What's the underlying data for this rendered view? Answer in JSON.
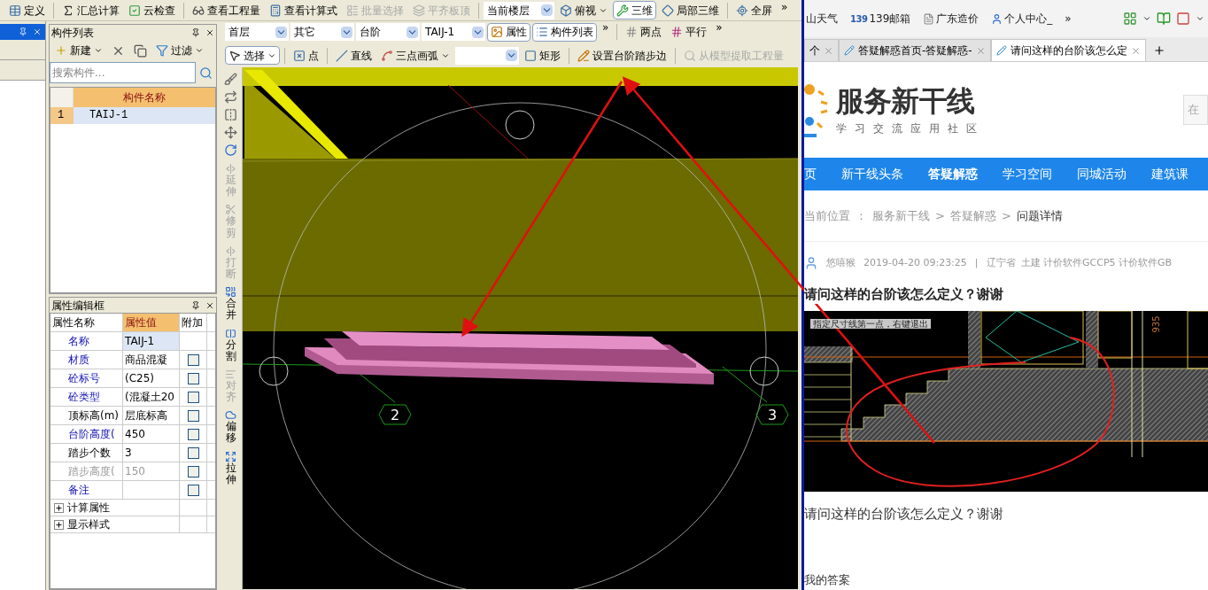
{
  "main_toolbar": [
    {
      "kind": "button",
      "label": "定义",
      "disabled": false,
      "pressed": false,
      "caret": false
    },
    {
      "kind": "separator"
    },
    {
      "kind": "button",
      "label": "汇总计算",
      "disabled": false,
      "pressed": false,
      "caret": false
    },
    {
      "kind": "button",
      "label": "云检查",
      "disabled": false,
      "pressed": false,
      "caret": false
    },
    {
      "kind": "separator"
    },
    {
      "kind": "button",
      "label": "查看工程量",
      "disabled": false,
      "pressed": false,
      "caret": false
    },
    {
      "kind": "button",
      "label": "查看计算式",
      "disabled": false,
      "pressed": false,
      "caret": false
    },
    {
      "kind": "button",
      "label": "批量选择",
      "disabled": true,
      "pressed": false,
      "caret": false
    },
    {
      "kind": "button",
      "label": "平齐板顶",
      "disabled": true,
      "pressed": false,
      "caret": false
    },
    {
      "kind": "separator"
    },
    {
      "kind": "dropdown",
      "value": "当前楼层"
    },
    {
      "kind": "button",
      "label": "俯视",
      "disabled": false,
      "pressed": false,
      "caret": true
    },
    {
      "kind": "button",
      "label": "三维",
      "disabled": false,
      "pressed": true,
      "caret": false
    },
    {
      "kind": "button",
      "label": "局部三维",
      "disabled": false,
      "pressed": false,
      "caret": false
    },
    {
      "kind": "separator"
    },
    {
      "kind": "button",
      "label": "全屏",
      "disabled": false,
      "pressed": false,
      "caret": false
    },
    {
      "kind": "more",
      "label": "»"
    }
  ],
  "component_list": {
    "title": "构件列表",
    "toolbar": [
      {
        "kind": "button",
        "label": "新建",
        "disabled": false,
        "pressed": false,
        "caret": true
      },
      {
        "kind": "icon"
      },
      {
        "kind": "icon"
      },
      {
        "kind": "button",
        "label": "过滤",
        "disabled": false,
        "pressed": false,
        "caret": true
      }
    ],
    "search": {
      "placeholder": "搜索构件..."
    },
    "column": "构件名称",
    "rows": [
      {
        "index": "1",
        "name": "TAIJ-1",
        "selected": true
      }
    ]
  },
  "property_editor": {
    "title": "属性编辑框",
    "columns": [
      "属性名称",
      "属性值",
      "附加"
    ],
    "rows": [
      {
        "name": "名称",
        "value": "TAIJ-1",
        "kind": "public",
        "checkbox": false,
        "selected": true
      },
      {
        "name": "材质",
        "value": "商品混凝",
        "kind": "public",
        "checkbox": true,
        "selected": false
      },
      {
        "name": "砼标号",
        "value": "(C25)",
        "kind": "public",
        "checkbox": true,
        "selected": false
      },
      {
        "name": "砼类型",
        "value": "(混凝土20",
        "kind": "public",
        "checkbox": true,
        "selected": false
      },
      {
        "name": "顶标高(m)",
        "value": "层底标高",
        "kind": "private",
        "checkbox": true,
        "selected": false
      },
      {
        "name": "台阶高度(",
        "value": "450",
        "kind": "public",
        "checkbox": true,
        "selected": false
      },
      {
        "name": "踏步个数",
        "value": "3",
        "kind": "private",
        "checkbox": true,
        "selected": false
      },
      {
        "name": "踏步高度(",
        "value": "150",
        "kind": "disabled",
        "checkbox": true,
        "selected": false
      },
      {
        "name": "备注",
        "value": "",
        "kind": "public",
        "checkbox": true,
        "selected": false
      }
    ],
    "groups": [
      {
        "label": "计算属性",
        "expanded": false
      },
      {
        "label": "显示样式",
        "expanded": false
      }
    ]
  },
  "floor_toolbar": [
    {
      "kind": "dropdown",
      "value": "首层"
    },
    {
      "kind": "dropdown",
      "value": "其它"
    },
    {
      "kind": "dropdown",
      "value": "台阶"
    },
    {
      "kind": "dropdown",
      "value": "TAIJ-1"
    },
    {
      "kind": "button",
      "label": "属性",
      "disabled": false,
      "pressed": true,
      "caret": false
    },
    {
      "kind": "button",
      "label": "构件列表",
      "disabled": false,
      "pressed": true,
      "caret": false
    },
    {
      "kind": "more",
      "label": "»"
    },
    {
      "kind": "separator"
    },
    {
      "kind": "button",
      "label": "两点",
      "disabled": false,
      "pressed": false,
      "caret": false
    },
    {
      "kind": "button",
      "label": "平行",
      "disabled": false,
      "pressed": false,
      "caret": false
    },
    {
      "kind": "more",
      "label": "»"
    }
  ],
  "draw_toolbar": [
    {
      "kind": "button",
      "label": "选择",
      "disabled": false,
      "pressed": true,
      "caret": true
    },
    {
      "kind": "separator"
    },
    {
      "kind": "button",
      "label": "点",
      "disabled": false,
      "pressed": false,
      "caret": false
    },
    {
      "kind": "separator"
    },
    {
      "kind": "button",
      "label": "直线",
      "disabled": false,
      "pressed": false,
      "caret": false
    },
    {
      "kind": "button",
      "label": "三点画弧",
      "disabled": false,
      "pressed": false,
      "caret": true
    },
    {
      "kind": "dropdown"
    },
    {
      "kind": "button",
      "label": "矩形",
      "disabled": false,
      "pressed": false,
      "caret": false
    },
    {
      "kind": "separator"
    },
    {
      "kind": "button",
      "label": "设置台阶踏步边",
      "disabled": false,
      "pressed": false,
      "caret": false
    },
    {
      "kind": "separator"
    },
    {
      "kind": "button",
      "label": "从模型提取工程量",
      "disabled": true,
      "pressed": false,
      "caret": false
    }
  ],
  "edit_tools": [
    {
      "label": "延伸",
      "disabled": true
    },
    {
      "label": "修剪",
      "disabled": true
    },
    {
      "label": "打断",
      "disabled": true
    },
    {
      "label": "合并",
      "disabled": false
    },
    {
      "label": "分割",
      "disabled": false
    },
    {
      "label": "对齐",
      "disabled": true
    },
    {
      "label": "偏移",
      "disabled": false
    },
    {
      "label": "拉伸",
      "disabled": false
    }
  ],
  "viewport": {
    "axis_labels": [
      "2",
      "3"
    ]
  },
  "browser": {
    "bookmarks": [
      {
        "label": "山天气"
      },
      {
        "label": "139邮箱",
        "badge": "139"
      },
      {
        "label": "广东造价"
      },
      {
        "label": "个人中心_"
      },
      {
        "label": "»"
      }
    ],
    "tabs": [
      {
        "label": "个",
        "selected": false
      },
      {
        "label": "答疑解惑首页-答疑解惑-",
        "selected": false
      },
      {
        "label": "请问这样的台阶该怎么定",
        "selected": true
      }
    ],
    "logo": {
      "title": "服务新干线",
      "subtitle": "学习交流应用社区"
    },
    "search": {
      "placeholder": "在"
    },
    "nav": [
      {
        "label": "页",
        "selected": false
      },
      {
        "label": "新干线头条",
        "selected": false
      },
      {
        "label": "答疑解惑",
        "selected": true
      },
      {
        "label": "学习空间",
        "selected": false
      },
      {
        "label": "同城活动",
        "selected": false
      },
      {
        "label": "建筑课",
        "selected": false
      }
    ],
    "breadcrumb": [
      "当前位置",
      "：",
      "服务新干线",
      ">",
      "答疑解惑",
      ">",
      "问题详情"
    ],
    "meta": {
      "author": "悠嘻猴",
      "date": "2019-04-20 09:23:25",
      "divider": "|",
      "region": "辽宁省",
      "tags": "土建 计价软件GCCP5 计价软件GB"
    },
    "title": "请问这样的台阶该怎么定义？谢谢",
    "image": {
      "hint": "指定尺寸线第一点，右键退出",
      "dimension": "935"
    },
    "body": "请问这样的台阶该怎么定义？谢谢",
    "answer_heading": "我的答案"
  }
}
